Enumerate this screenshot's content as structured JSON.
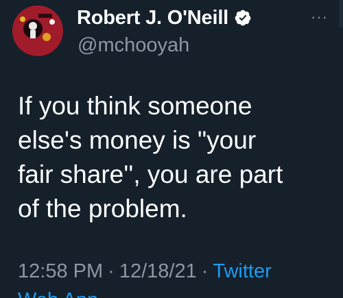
{
  "author": {
    "display_name": "Robert J. O'Neill",
    "handle": "@mchooyah",
    "verified": true,
    "avatar_icon": "profile-avatar"
  },
  "more_menu_label": "···",
  "tweet": {
    "text_lines": [
      "If you think someone",
      "else's money is \"your",
      "fair share'', you are part",
      "of the problem."
    ]
  },
  "meta": {
    "time": "12:58 PM",
    "separator": "·",
    "date": "12/18/21",
    "source": "Twitter",
    "source_continued": "Web App"
  },
  "colors": {
    "background": "#15202b",
    "primary_text": "#ffffff",
    "secondary_text": "#8b98a5",
    "accent": "#1d9bf0"
  }
}
